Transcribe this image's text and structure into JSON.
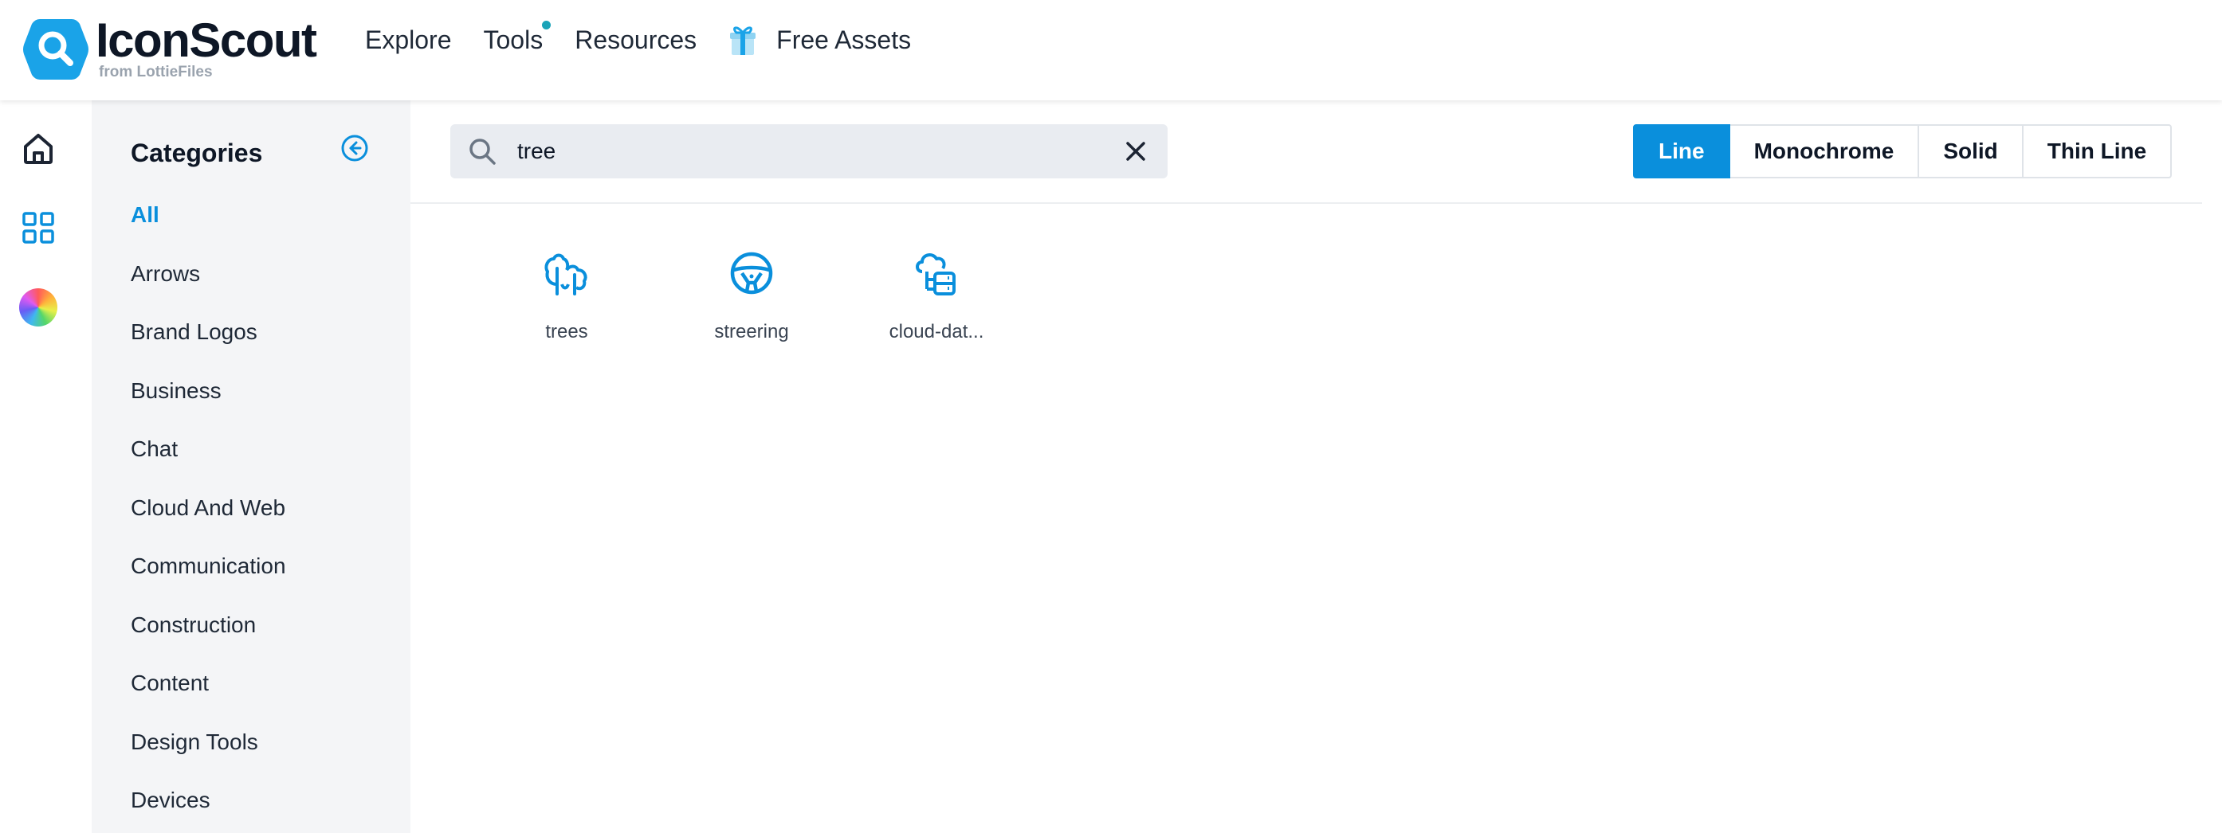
{
  "brand": {
    "name": "IconScout",
    "sub": "from LottieFiles",
    "accent": "#0a8fdc"
  },
  "nav": {
    "explore": "Explore",
    "tools": "Tools",
    "resources": "Resources",
    "free_assets": "Free Assets"
  },
  "rail": {
    "icons": [
      "home-icon",
      "grid-icon",
      "color-wheel-icon"
    ]
  },
  "categories": {
    "title": "Categories",
    "items": [
      "All",
      "Arrows",
      "Brand Logos",
      "Business",
      "Chat",
      "Cloud And Web",
      "Communication",
      "Construction",
      "Content",
      "Design Tools",
      "Devices"
    ],
    "active": "All"
  },
  "search": {
    "value": "tree",
    "placeholder": ""
  },
  "styles": {
    "items": [
      "Line",
      "Monochrome",
      "Solid",
      "Thin Line"
    ],
    "active": "Line"
  },
  "results": [
    {
      "label": "trees",
      "icon": "trees-icon"
    },
    {
      "label": "streering",
      "icon": "steering-wheel-icon"
    },
    {
      "label": "cloud-dat...",
      "icon": "cloud-database-icon"
    }
  ]
}
